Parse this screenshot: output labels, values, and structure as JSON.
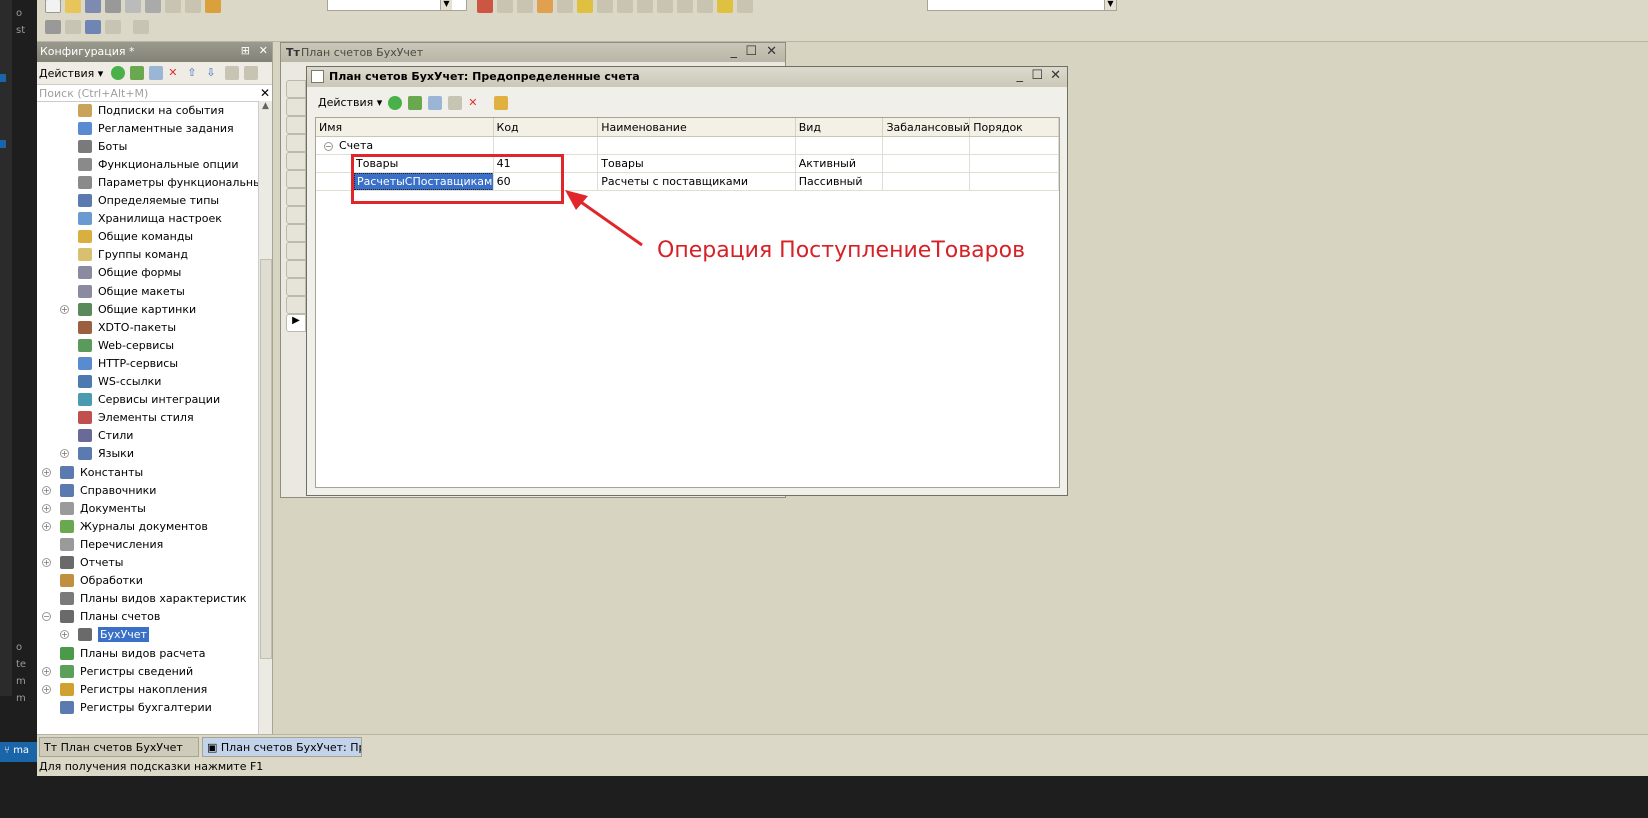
{
  "editor_sidebar": {
    "items": [
      "o",
      "st",
      "o",
      "te",
      "m",
      "m"
    ],
    "branch": "ma"
  },
  "config_panel": {
    "title": "Конфигурация *",
    "actions_label": "Действия",
    "search_placeholder": "Поиск (Ctrl+Alt+M)",
    "tree": [
      {
        "label": "Подписки на события",
        "level": 1
      },
      {
        "label": "Регламентные задания",
        "level": 1
      },
      {
        "label": "Боты",
        "level": 1
      },
      {
        "label": "Функциональные опции",
        "level": 1
      },
      {
        "label": "Параметры функциональных опц",
        "level": 1
      },
      {
        "label": "Определяемые типы",
        "level": 1
      },
      {
        "label": "Хранилища настроек",
        "level": 1
      },
      {
        "label": "Общие команды",
        "level": 1
      },
      {
        "label": "Группы команд",
        "level": 1
      },
      {
        "label": "Общие формы",
        "level": 1
      },
      {
        "label": "Общие макеты",
        "level": 1
      },
      {
        "label": "Общие картинки",
        "level": 1,
        "expand": true
      },
      {
        "label": "XDTO-пакеты",
        "level": 1
      },
      {
        "label": "Web-сервисы",
        "level": 1
      },
      {
        "label": "HTTP-сервисы",
        "level": 1
      },
      {
        "label": "WS-ссылки",
        "level": 1
      },
      {
        "label": "Сервисы интеграции",
        "level": 1
      },
      {
        "label": "Элементы стиля",
        "level": 1
      },
      {
        "label": "Стили",
        "level": 1
      },
      {
        "label": "Языки",
        "level": 1,
        "expand": true
      },
      {
        "label": "Константы",
        "level": 0,
        "expand": true
      },
      {
        "label": "Справочники",
        "level": 0,
        "expand": true
      },
      {
        "label": "Документы",
        "level": 0,
        "expand": true
      },
      {
        "label": "Журналы документов",
        "level": 0,
        "expand": true
      },
      {
        "label": "Перечисления",
        "level": 0
      },
      {
        "label": "Отчеты",
        "level": 0,
        "expand": true
      },
      {
        "label": "Обработки",
        "level": 0
      },
      {
        "label": "Планы видов характеристик",
        "level": 0
      },
      {
        "label": "Планы счетов",
        "level": 0,
        "collapse": true
      },
      {
        "label": "БухУчет",
        "level": 1,
        "expand": true,
        "selected": true
      },
      {
        "label": "Планы видов расчета",
        "level": 0
      },
      {
        "label": "Регистры сведений",
        "level": 0,
        "expand": true
      },
      {
        "label": "Регистры накопления",
        "level": 0,
        "expand": true
      },
      {
        "label": "Регистры бухгалтерии",
        "level": 0
      }
    ]
  },
  "window_back": {
    "title": "План счетов БухУчет"
  },
  "window_front": {
    "title": "План счетов БухУчет: Предопределенные счета",
    "actions_label": "Действия",
    "columns": [
      "Имя",
      "Код",
      "Наименование",
      "Вид",
      "Забалансовый",
      "Порядок"
    ],
    "group": "Счета",
    "rows": [
      {
        "name": "Товары",
        "code": "41",
        "title": "Товары",
        "kind": "Активный",
        "offbalance": "",
        "order": ""
      },
      {
        "name": "РасчетыСПоставщиками",
        "code": "60",
        "title": "Расчеты с поставщиками",
        "kind": "Пассивный",
        "offbalance": "",
        "order": ""
      }
    ]
  },
  "annotation": {
    "text": "Операция ПоступлениеТоваров",
    "color": "#d62127"
  },
  "taskbar": {
    "tabs": [
      "План счетов БухУчет",
      "План счетов БухУчет: Пре..."
    ]
  },
  "status": {
    "text": "Для получения подсказки нажмите F1"
  }
}
